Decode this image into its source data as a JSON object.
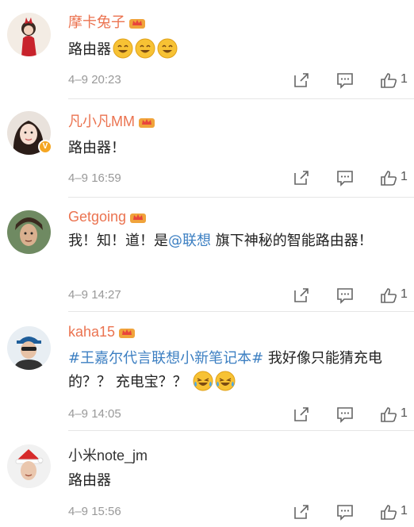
{
  "comments": [
    {
      "username": "摩卡兔子",
      "vip": true,
      "verified": false,
      "content": [
        {
          "t": "text",
          "v": "路由器"
        },
        {
          "t": "emoji",
          "v": "smile-emoji"
        },
        {
          "t": "emoji",
          "v": "smile-emoji"
        },
        {
          "t": "emoji",
          "v": "smile-emoji"
        }
      ],
      "timestamp": "4–9 20:23",
      "likes": "1"
    },
    {
      "username": "凡小凡MM",
      "vip": true,
      "verified": true,
      "content": [
        {
          "t": "text",
          "v": "路由器！"
        }
      ],
      "timestamp": "4–9 16:59",
      "likes": "1"
    },
    {
      "username": "Getgoing",
      "vip": true,
      "verified": false,
      "content": [
        {
          "t": "text",
          "v": "我！知！道！是"
        },
        {
          "t": "mention",
          "v": "@联想"
        },
        {
          "t": "text",
          "v": " 旗下神秘的智能路由器！"
        }
      ],
      "timestamp": "4–9 14:27",
      "likes": "1"
    },
    {
      "username": "kaha15",
      "vip": true,
      "verified": false,
      "content": [
        {
          "t": "topic",
          "v": "#王嘉尔代言联想小新笔记本#"
        },
        {
          "t": "text",
          "v": " 我好像只能猜充电的？？ 充电宝？？ "
        },
        {
          "t": "emoji",
          "v": "laugh-cry-emoji"
        },
        {
          "t": "emoji",
          "v": "laugh-cry-emoji"
        }
      ],
      "timestamp": "4–9 14:05",
      "likes": "1"
    },
    {
      "username": "小米note_jm",
      "vip": false,
      "verified": false,
      "content": [
        {
          "t": "text",
          "v": "路由器"
        }
      ],
      "timestamp": "4–9 15:56",
      "likes": "1"
    }
  ],
  "icons": {
    "share": "share-icon",
    "comment": "comment-icon",
    "like": "like-icon",
    "vip": "crown-icon"
  },
  "colors": {
    "vip_name": "#eb7350",
    "link": "#3c7fc2",
    "meta": "#999999",
    "badge": "#f5a623"
  }
}
